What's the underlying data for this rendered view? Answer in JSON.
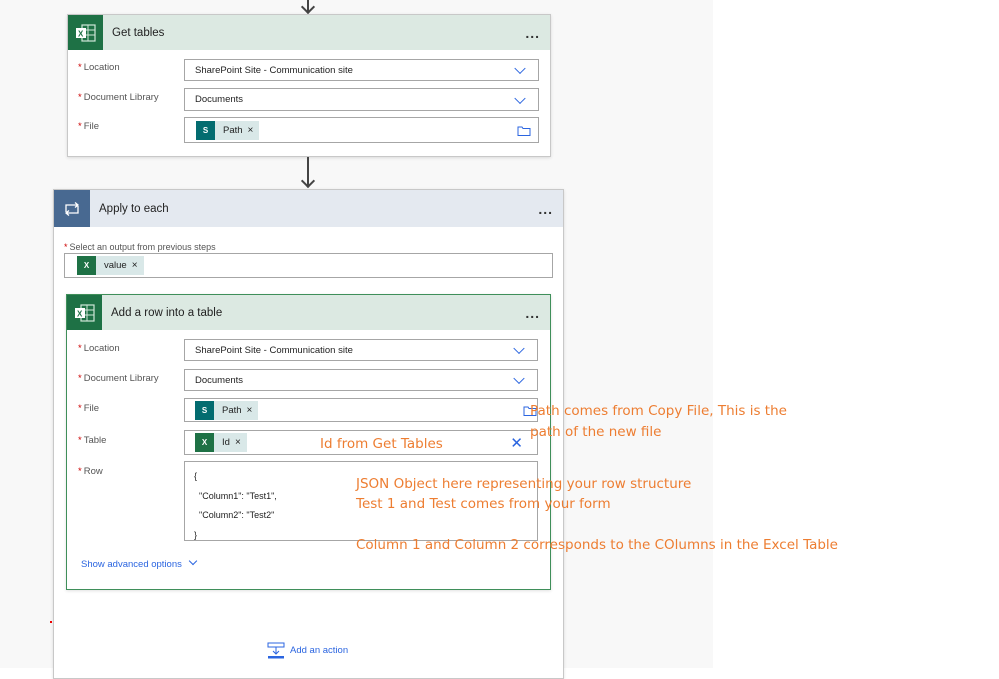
{
  "get_tables": {
    "title": "Get tables",
    "more_label": "...",
    "fields": [
      {
        "label": "Location",
        "value": "SharePoint Site - Communication site"
      },
      {
        "label": "Document Library",
        "value": "Documents"
      },
      {
        "label": "File",
        "token": "Path"
      }
    ]
  },
  "apply_each": {
    "title": "Apply to each",
    "more_label": "...",
    "select_label": "Select an output from previous steps",
    "select_token": "value"
  },
  "add_row": {
    "title": "Add a row into a table",
    "more_label": "...",
    "fields": [
      {
        "label": "Location",
        "value": "SharePoint Site - Communication site"
      },
      {
        "label": "Document Library",
        "value": "Documents"
      },
      {
        "label": "File",
        "token": "Path"
      },
      {
        "label": "Table",
        "token": "Id"
      },
      {
        "label": "Row",
        "lines": [
          "{",
          "  \"Column1\": \"Test1\",",
          "  \"Column2\": \"Test2\"",
          "}"
        ]
      }
    ],
    "advanced_label": "Show advanced options"
  },
  "add_action_label": "Add an action",
  "token_remove": "×",
  "required_mark": "*",
  "annotations": {
    "path_1": "Path comes from Copy File, This is the",
    "path_2": "path of the new file",
    "id": "Id from Get Tables",
    "json_1": "JSON Object here representing your row structure",
    "json_2": "Test 1 and Test comes from your form",
    "columns": "Column 1 and Column 2 corresponds to the COlumns in the Excel Table"
  },
  "colors": {
    "excel": "#1e7145",
    "sharepoint": "#036c70",
    "loop": "#486991",
    "accent": "#2b65e0",
    "annotation": "#ed7d31"
  }
}
